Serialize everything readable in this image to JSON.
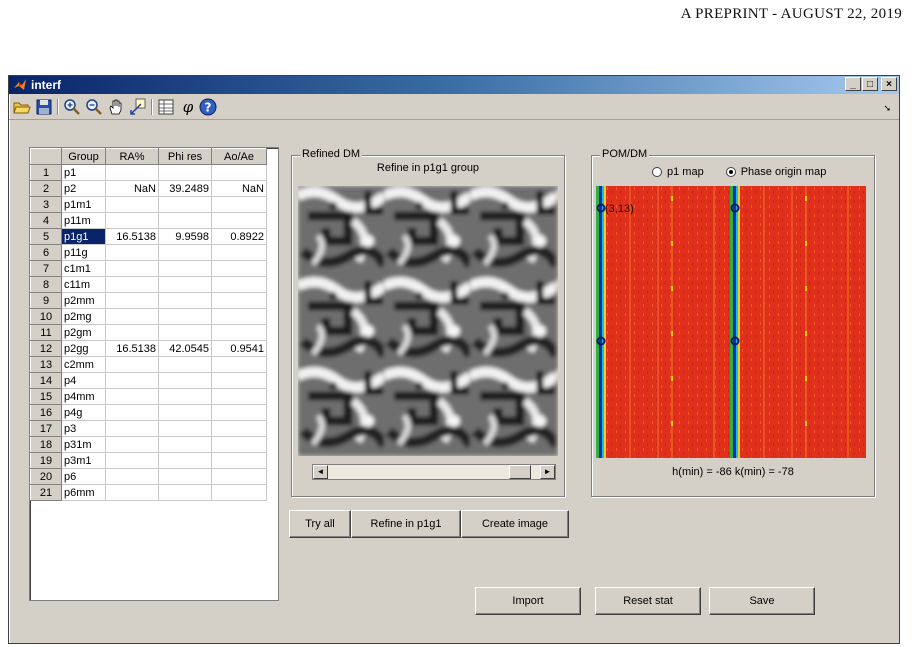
{
  "page_header": "A PREPRINT - AUGUST 22, 2019",
  "window": {
    "title": "interf"
  },
  "toolbar": {
    "icons": [
      "open-folder-icon",
      "save-disk-icon",
      "zoom-in-icon",
      "zoom-out-icon",
      "pan-hand-icon",
      "data-cursor-icon",
      "table-icon",
      "phi-icon",
      "help-icon"
    ],
    "phi_label": "φ"
  },
  "table": {
    "headers": [
      "",
      "Group",
      "RA%",
      "Phi res",
      "Ao/Ae"
    ],
    "selected_row": 5,
    "rows": [
      {
        "num": "1",
        "group": "p1",
        "ra": "",
        "phi": "",
        "ao": ""
      },
      {
        "num": "2",
        "group": "p2",
        "ra": "NaN",
        "phi": "39.2489",
        "ao": "NaN"
      },
      {
        "num": "3",
        "group": "p1m1",
        "ra": "",
        "phi": "",
        "ao": ""
      },
      {
        "num": "4",
        "group": "p11m",
        "ra": "",
        "phi": "",
        "ao": ""
      },
      {
        "num": "5",
        "group": "p1g1",
        "ra": "16.5138",
        "phi": "9.9598",
        "ao": "0.8922"
      },
      {
        "num": "6",
        "group": "p11g",
        "ra": "",
        "phi": "",
        "ao": ""
      },
      {
        "num": "7",
        "group": "c1m1",
        "ra": "",
        "phi": "",
        "ao": ""
      },
      {
        "num": "8",
        "group": "c11m",
        "ra": "",
        "phi": "",
        "ao": ""
      },
      {
        "num": "9",
        "group": "p2mm",
        "ra": "",
        "phi": "",
        "ao": ""
      },
      {
        "num": "10",
        "group": "p2mg",
        "ra": "",
        "phi": "",
        "ao": ""
      },
      {
        "num": "11",
        "group": "p2gm",
        "ra": "",
        "phi": "",
        "ao": ""
      },
      {
        "num": "12",
        "group": "p2gg",
        "ra": "16.5138",
        "phi": "42.0545",
        "ao": "0.9541"
      },
      {
        "num": "13",
        "group": "c2mm",
        "ra": "",
        "phi": "",
        "ao": ""
      },
      {
        "num": "14",
        "group": "p4",
        "ra": "",
        "phi": "",
        "ao": ""
      },
      {
        "num": "15",
        "group": "p4mm",
        "ra": "",
        "phi": "",
        "ao": ""
      },
      {
        "num": "16",
        "group": "p4g",
        "ra": "",
        "phi": "",
        "ao": ""
      },
      {
        "num": "17",
        "group": "p3",
        "ra": "",
        "phi": "",
        "ao": ""
      },
      {
        "num": "18",
        "group": "p31m",
        "ra": "",
        "phi": "",
        "ao": ""
      },
      {
        "num": "19",
        "group": "p3m1",
        "ra": "",
        "phi": "",
        "ao": ""
      },
      {
        "num": "20",
        "group": "p6",
        "ra": "",
        "phi": "",
        "ao": ""
      },
      {
        "num": "21",
        "group": "p6mm",
        "ra": "",
        "phi": "",
        "ao": ""
      }
    ]
  },
  "refined_panel": {
    "legend": "Refined DM",
    "subtitle": "Refine in p1g1 group",
    "scroll_left": "◄",
    "scroll_right": "►"
  },
  "pom_panel": {
    "legend": "POM/DM",
    "radio_p1": "p1 map",
    "radio_phase": "Phase origin map",
    "selected_radio": "phase",
    "marker_label": "(3,13)",
    "hk_text": "h(min) = -86 k(min) = -78"
  },
  "buttons": {
    "try_all": "Try all",
    "refine": "Refine in p1g1",
    "create_image": "Create image",
    "import": "Import",
    "reset_stat": "Reset stat",
    "save": "Save"
  },
  "colors": {
    "titlebar_start": "#0a246a",
    "window_bg": "#d4d0c8",
    "map_red": "#e8321e",
    "selection": "#0a246a"
  }
}
